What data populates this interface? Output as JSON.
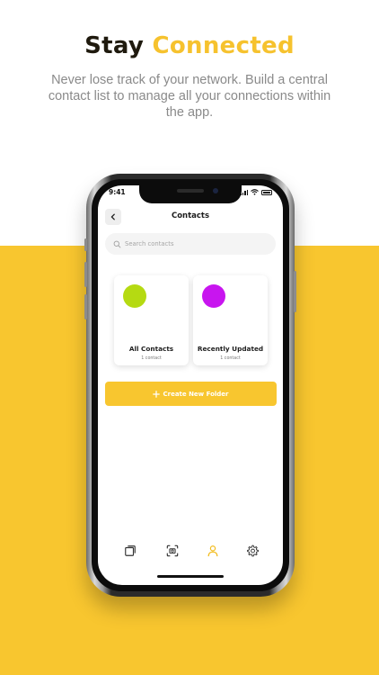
{
  "hero": {
    "title_word1": "Stay",
    "title_word2": "Connected",
    "subtitle": "Never lose track of your network. Build a central contact list to manage all your connections within the app."
  },
  "status_bar": {
    "time": "9:41"
  },
  "screen": {
    "title": "Contacts",
    "search_placeholder": "Search contacts",
    "folders": [
      {
        "name": "All Contacts",
        "count": "1 contact",
        "color": "#B5DA12"
      },
      {
        "name": "Recently Updated",
        "count": "1 contact",
        "color": "#C815EF"
      }
    ],
    "create_button_label": "Create New Folder"
  },
  "tabs": [
    {
      "icon": "cards-icon",
      "active": false
    },
    {
      "icon": "scan-icon",
      "active": false
    },
    {
      "icon": "user-icon",
      "active": true
    },
    {
      "icon": "gear-icon",
      "active": false
    }
  ],
  "colors": {
    "accent": "#F8C62F",
    "dark": "#1f1a0e"
  }
}
